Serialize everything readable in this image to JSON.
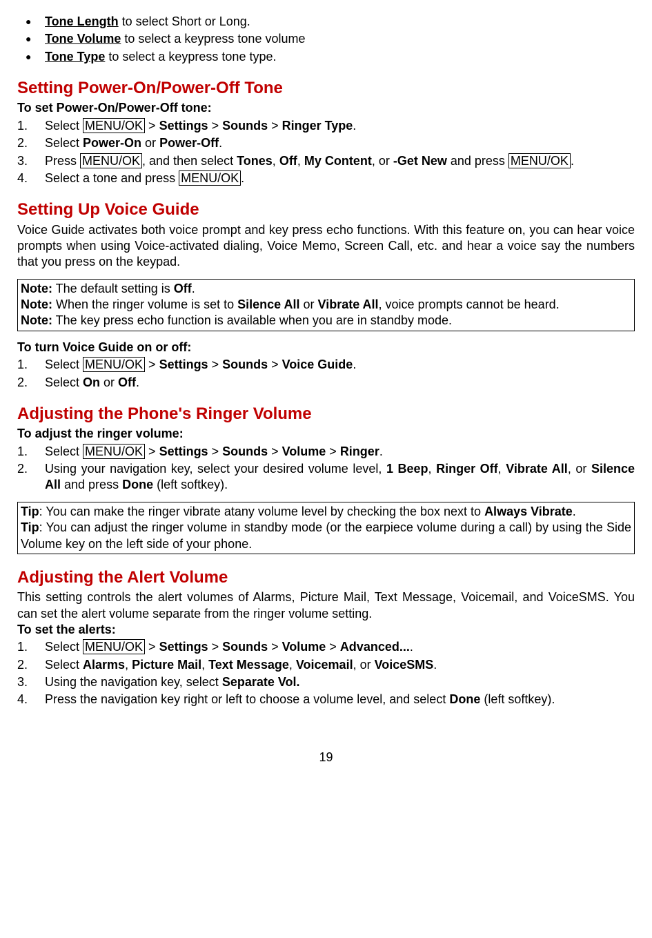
{
  "bullets": {
    "tone_length": "Tone Length",
    "tone_length_desc": " to select Short or Long.",
    "tone_volume": "Tone Volume",
    "tone_volume_desc": " to select a keypress tone volume",
    "tone_type": "Tone Type",
    "tone_type_desc": " to select a keypress tone type."
  },
  "power_tone": {
    "header": "Setting Power-On/Power-Off Tone",
    "sub": "To set Power-On/Power-Off tone:",
    "step1_a": "Select ",
    "step1_menu": "MENU/OK",
    "step1_b": " > ",
    "step1_settings": "Settings",
    "step1_c": " > ",
    "step1_sounds": "Sounds",
    "step1_d": " > ",
    "step1_ringer": "Ringer Type",
    "step1_e": ".",
    "step2_a": "Select ",
    "step2_poweron": "Power-On",
    "step2_or": " or ",
    "step2_poweroff": "Power-Off",
    "step2_e": ".",
    "step3_a": "Press ",
    "step3_menu": "MENU/OK",
    "step3_b": ", and then select ",
    "step3_tones": "Tones",
    "step3_c": ", ",
    "step3_off": "Off",
    "step3_d": ", ",
    "step3_my": "My Content",
    "step3_e": ", or ",
    "step3_get": "-Get New",
    "step3_f": " and press ",
    "step3_menu2": "MENU/OK",
    "step3_g": ".",
    "step4_a": "Select a tone and press ",
    "step4_menu": "MENU/OK",
    "step4_b": "."
  },
  "voice_guide": {
    "header": "Setting Up Voice Guide",
    "desc": "Voice Guide activates both voice prompt and key press echo functions. With this feature on, you can hear voice prompts when using Voice-activated dialing, Voice Memo, Screen Call, etc. and hear a voice say the numbers that you press on the keypad.",
    "note1_a": "Note:",
    "note1_b": " The default setting is ",
    "note1_off": "Off",
    "note1_c": ".",
    "note2_a": "Note:",
    "note2_b": " When the ringer volume is set to ",
    "note2_silence": "Silence All",
    "note2_c": " or ",
    "note2_vibrate": "Vibrate All",
    "note2_d": ", voice prompts cannot be heard.",
    "note3_a": "Note:",
    "note3_b": " The key press echo function is available when you are in standby mode.",
    "sub": "To turn Voice Guide on or off:",
    "step1_a": "Select ",
    "step1_menu": "MENU/OK",
    "step1_b": " > ",
    "step1_settings": "Settings",
    "step1_c": " > ",
    "step1_sounds": "Sounds",
    "step1_d": " > ",
    "step1_vg": "Voice Guide",
    "step1_e": ".",
    "step2_a": "Select ",
    "step2_on": "On",
    "step2_or": " or ",
    "step2_off": "Off",
    "step2_e": "."
  },
  "ringer": {
    "header": "Adjusting the Phone's Ringer Volume",
    "sub": "To adjust the ringer volume:",
    "step1_a": "Select ",
    "step1_menu": "MENU/OK",
    "step1_b": " > ",
    "step1_settings": "Settings",
    "step1_c": " > ",
    "step1_sounds": "Sounds",
    "step1_d": " > ",
    "step1_volume": "Volume",
    "step1_e": " > ",
    "step1_ringer": "Ringer",
    "step1_f": ".",
    "step2_a": "Using your navigation key, select your desired volume level, ",
    "step2_1beep": "1 Beep",
    "step2_b": ", ",
    "step2_roff": "Ringer Off",
    "step2_c": ", ",
    "step2_vall": "Vibrate All",
    "step2_d": ", or ",
    "step2_sall": "Silence All",
    "step2_e": " and press ",
    "step2_done": "Done",
    "step2_f": " (left softkey).",
    "tip1_a": "Tip",
    "tip1_b": ": You can make the ringer vibrate atany volume level by checking the box next to ",
    "tip1_always": "Always Vibrate",
    "tip1_c": ".",
    "tip2_a": "Tip",
    "tip2_b": ": You can adjust the ringer volume in standby mode (or the earpiece volume during a call) by using the Side Volume key on the left side of your phone."
  },
  "alert": {
    "header": "Adjusting the Alert Volume",
    "desc": "This setting controls the alert volumes of Alarms, Picture Mail, Text Message, Voicemail, and VoiceSMS. You can set the alert volume separate from the ringer volume setting.",
    "sub": "To set the alerts:",
    "step1_a": "Select ",
    "step1_menu": "MENU/OK",
    "step1_b": " > ",
    "step1_settings": "Settings",
    "step1_c": " > ",
    "step1_sounds": "Sounds",
    "step1_d": " > ",
    "step1_volume": "Volume",
    "step1_e": " > ",
    "step1_adv": "Advanced...",
    "step1_f": ".",
    "step2_a": "Select ",
    "step2_alarms": "Alarms",
    "step2_b": ", ",
    "step2_pic": "Picture Mail",
    "step2_c": ", ",
    "step2_text": "Text Message",
    "step2_d": ", ",
    "step2_vm": "Voicemail",
    "step2_e": ", or ",
    "step2_vsms": "VoiceSMS",
    "step2_f": ".",
    "step3_a": "Using the navigation key, select ",
    "step3_sep": "Separate Vol.",
    "step4_a": "Press the navigation key right or left to choose a volume level, and select ",
    "step4_done": "Done",
    "step4_b": " (left softkey)."
  },
  "page": "19"
}
